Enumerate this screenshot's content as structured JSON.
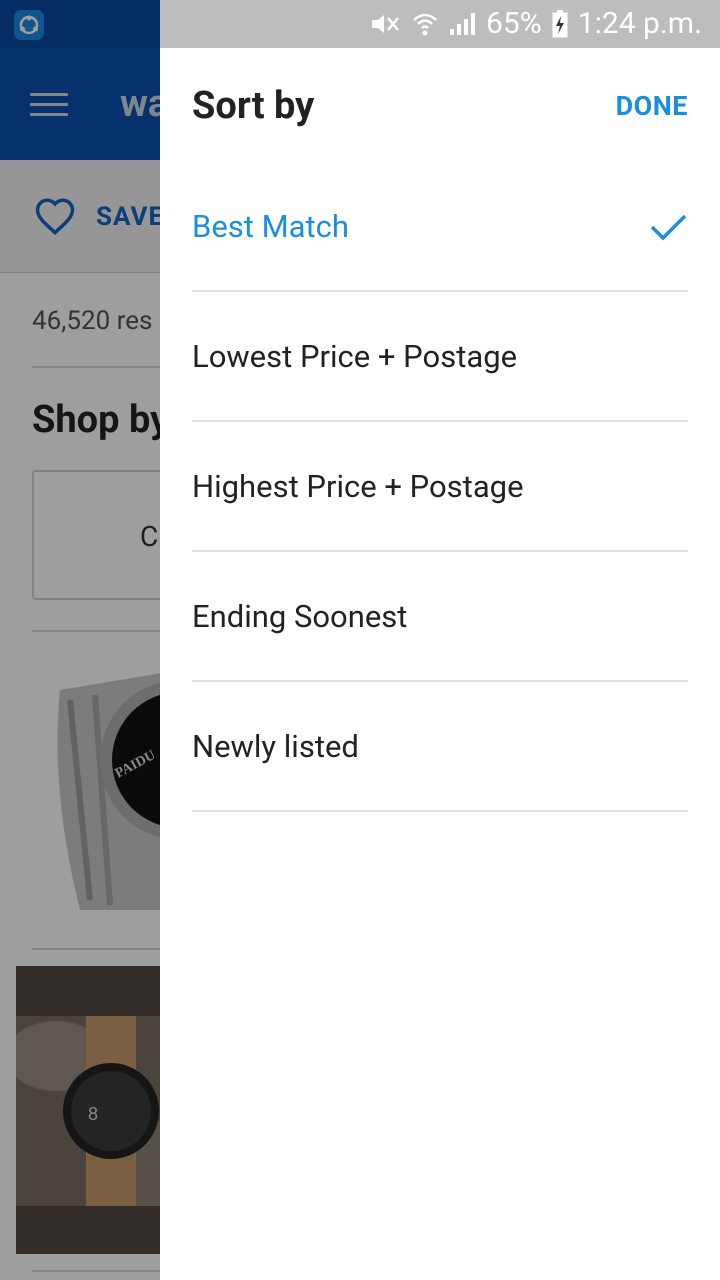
{
  "status_bar": {
    "battery": "65%",
    "time": "1:24 p.m."
  },
  "background": {
    "app_title_partial": "wa",
    "save_label_partial": "SAVE",
    "results_partial": "46,520 res",
    "shop_by_partial": "Shop by",
    "chip_letter": "C",
    "watch_brand": "PAIDU"
  },
  "sort_panel": {
    "title": "Sort by",
    "done_label": "DONE",
    "selected_index": 0,
    "accent_color": "#1a8fe0",
    "options": [
      {
        "label": "Best Match"
      },
      {
        "label": "Lowest Price + Postage"
      },
      {
        "label": "Highest Price + Postage"
      },
      {
        "label": "Ending Soonest"
      },
      {
        "label": "Newly listed"
      }
    ]
  }
}
